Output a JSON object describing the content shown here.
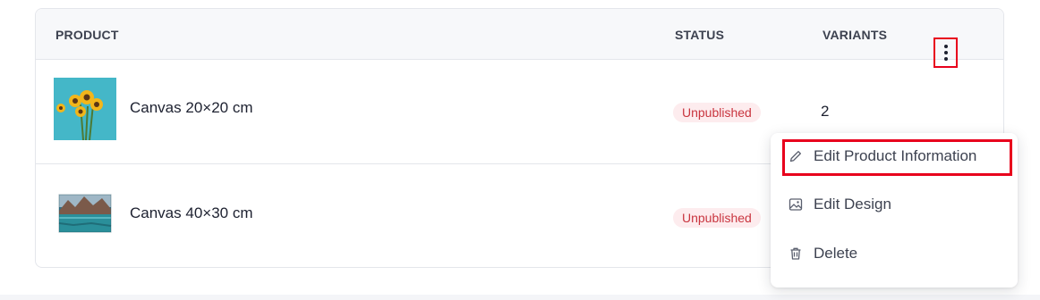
{
  "table": {
    "headers": {
      "product": "PRODUCT",
      "status": "STATUS",
      "variants": "VARIANTS"
    },
    "rows": [
      {
        "name": "Canvas 20×20 cm",
        "status": "Unpublished",
        "variants": "2",
        "thumbnail": "sunflowers-image"
      },
      {
        "name": "Canvas 40×30 cm",
        "status": "Unpublished",
        "variants": "",
        "thumbnail": "mountain-lake-image"
      }
    ]
  },
  "menu": {
    "items": [
      {
        "label": "Edit Product Information",
        "icon": "pencil-icon"
      },
      {
        "label": "Edit Design",
        "icon": "image-icon"
      },
      {
        "label": "Delete",
        "icon": "trash-icon"
      }
    ]
  },
  "colors": {
    "badge_bg": "#fdecee",
    "badge_text": "#c9353f",
    "highlight": "#e8001c"
  }
}
